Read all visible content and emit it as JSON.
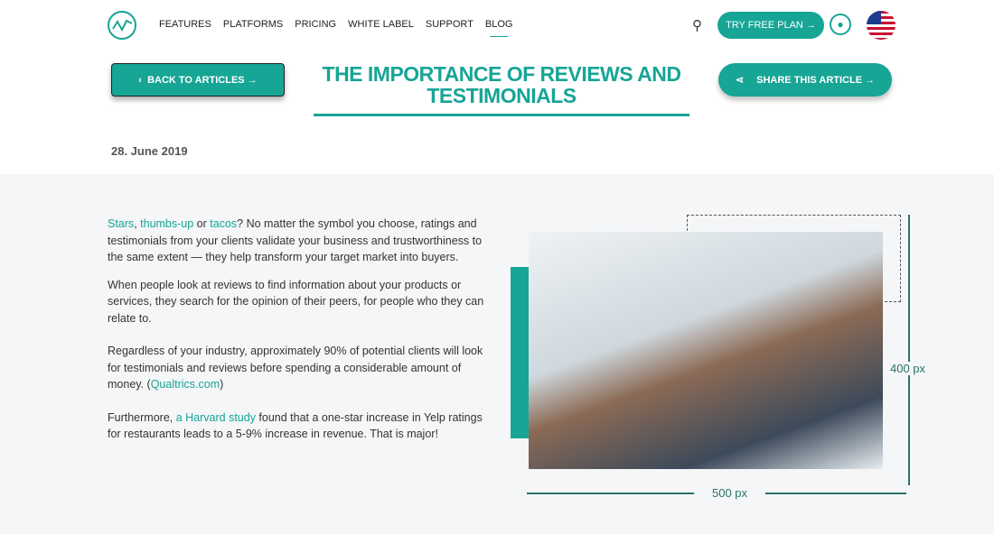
{
  "nav": {
    "items": [
      "FEATURES",
      "PLATFORMS",
      "PRICING",
      "WHITE LABEL",
      "SUPPORT",
      "BLOG"
    ],
    "active": "BLOG",
    "cta": "TRY FREE PLAN →"
  },
  "header": {
    "back": "BACK TO ARTICLES →",
    "title": "THE IMPORTANCE OF REVIEWS AND TESTIMONIALS",
    "share": "SHARE THIS ARTICLE →",
    "date": "28. June 2019"
  },
  "article": {
    "p1": {
      "l1": "Stars",
      "s1": ", ",
      "l2": "thumbs-up",
      "s2": " or ",
      "l3": "tacos",
      "rest": "? No matter the symbol you choose, ratings and testimonials from your clients validate your business and trustworthiness to the same extent — they help transform your target market into buyers."
    },
    "p2": "When people look at reviews to find information about your products or services, they search for the opinion of their peers, for people who they can relate to.",
    "p3": {
      "text": "Regardless of your industry, approximately 90% of potential clients will look for testimonials and reviews before spending a considerable amount of money. (",
      "link": "Qualtrics.com",
      "end": ")"
    },
    "p4": {
      "pre": "Furthermore, ",
      "link": "a Harvard study",
      "rest": " found that a one-star increase in Yelp ratings for restaurants leads to a 5-9% increase in revenue. That is major!"
    }
  },
  "figure": {
    "height_label": "400 px",
    "width_label": "500 px"
  },
  "colors": {
    "accent": "#17a596"
  }
}
